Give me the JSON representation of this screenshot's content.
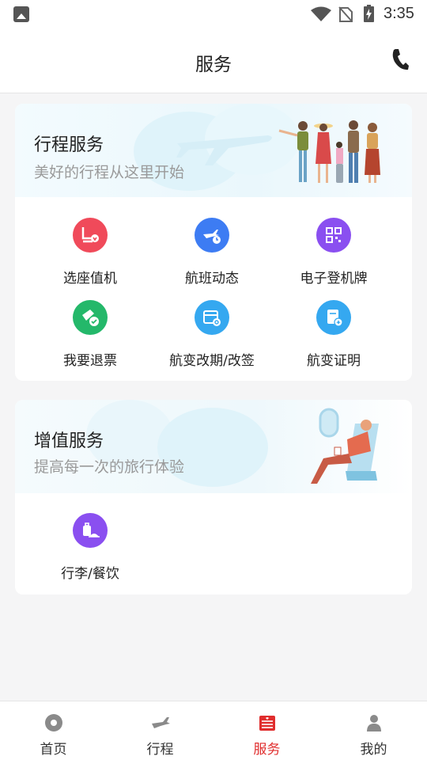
{
  "status_bar": {
    "time": "3:35"
  },
  "header": {
    "title": "服务"
  },
  "trip_services": {
    "title": "行程服务",
    "subtitle": "美好的行程从这里开始",
    "items": [
      {
        "label": "选座值机",
        "icon": "seat-checkin-icon",
        "color": "#f04a5a"
      },
      {
        "label": "航班动态",
        "icon": "flight-status-icon",
        "color": "#3d7cf3"
      },
      {
        "label": "电子登机牌",
        "icon": "qr-boarding-pass-icon",
        "color": "#8a4ff0"
      },
      {
        "label": "我要退票",
        "icon": "ticket-refund-icon",
        "color": "#24b86a"
      },
      {
        "label": "航变改期/改签",
        "icon": "reschedule-calendar-icon",
        "color": "#35a8f0"
      },
      {
        "label": "航变证明",
        "icon": "certificate-icon",
        "color": "#35a8f0"
      }
    ]
  },
  "value_services": {
    "title": "增值服务",
    "subtitle": "提高每一次的旅行体验",
    "items": [
      {
        "label": "行李/餐饮",
        "icon": "luggage-meal-icon",
        "color": "#8a4ff0"
      }
    ]
  },
  "tabbar": {
    "active_color": "#e02d2d",
    "tabs": [
      {
        "label": "首页",
        "icon": "home-icon"
      },
      {
        "label": "行程",
        "icon": "plane-icon"
      },
      {
        "label": "服务",
        "icon": "service-icon",
        "active": true
      },
      {
        "label": "我的",
        "icon": "profile-icon"
      }
    ]
  }
}
